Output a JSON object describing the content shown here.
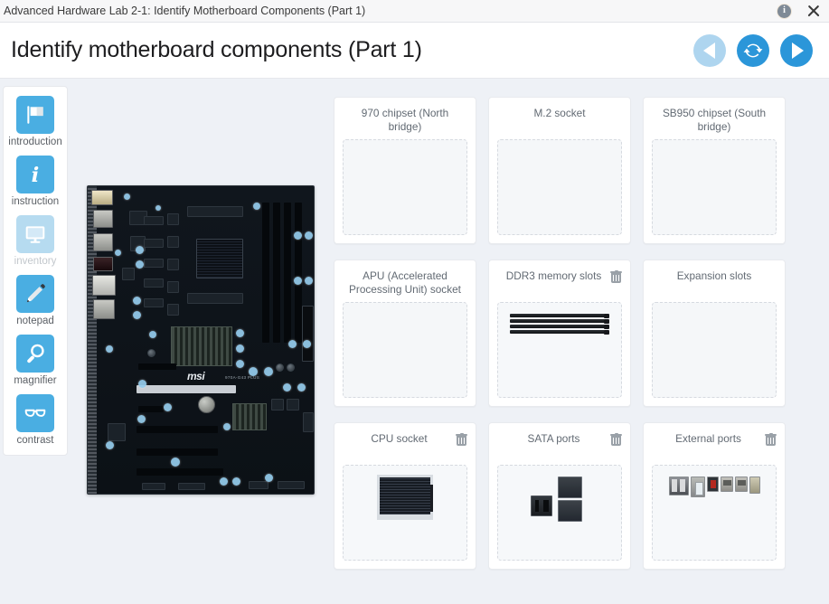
{
  "titlebar": {
    "text": "Advanced Hardware Lab 2-1: Identify Motherboard Components (Part 1)",
    "info_label": "i",
    "info_name": "info-icon",
    "close_name": "close-icon"
  },
  "header": {
    "title": "Identify motherboard components (Part 1)",
    "nav": {
      "prev_label": "previous",
      "reset_label": "reset",
      "next_label": "next"
    }
  },
  "sidebar": {
    "items": [
      {
        "label": "introduction",
        "icon": "flag-icon",
        "enabled": true
      },
      {
        "label": "instruction",
        "icon": "info-i-icon",
        "enabled": true
      },
      {
        "label": "inventory",
        "icon": "monitor-icon",
        "enabled": false
      },
      {
        "label": "notepad",
        "icon": "pencil-icon",
        "enabled": true
      },
      {
        "label": "magnifier",
        "icon": "magnifier-icon",
        "enabled": true
      },
      {
        "label": "contrast",
        "icon": "glasses-icon",
        "enabled": true
      }
    ]
  },
  "board": {
    "brand": "msi",
    "model": "970A-G43 PLUS",
    "alt": "motherboard-diagram"
  },
  "cards": [
    {
      "title": "970 chipset (North bridge)",
      "filled": false,
      "art": "none",
      "has_delete": false
    },
    {
      "title": "M.2 socket",
      "filled": false,
      "art": "none",
      "has_delete": false
    },
    {
      "title": "SB950 chipset (South bridge)",
      "filled": false,
      "art": "none",
      "has_delete": false
    },
    {
      "title": "APU (Accelerated Processing Unit) socket",
      "filled": false,
      "art": "none",
      "has_delete": false
    },
    {
      "title": "DDR3 memory slots",
      "filled": true,
      "art": "dimm",
      "has_delete": true
    },
    {
      "title": "Expansion slots",
      "filled": false,
      "art": "none",
      "has_delete": false
    },
    {
      "title": "CPU socket",
      "filled": true,
      "art": "cpu",
      "has_delete": true
    },
    {
      "title": "SATA ports",
      "filled": true,
      "art": "sata",
      "has_delete": true
    },
    {
      "title": "External ports",
      "filled": true,
      "art": "ports",
      "has_delete": true
    }
  ],
  "colors": {
    "accent": "#2b96d9",
    "accent_light": "#4aaee2",
    "accent_disabled": "#b6dbf0",
    "page_bg": "#eef1f6",
    "card_bg": "#ffffff",
    "text_muted": "#626a73"
  }
}
